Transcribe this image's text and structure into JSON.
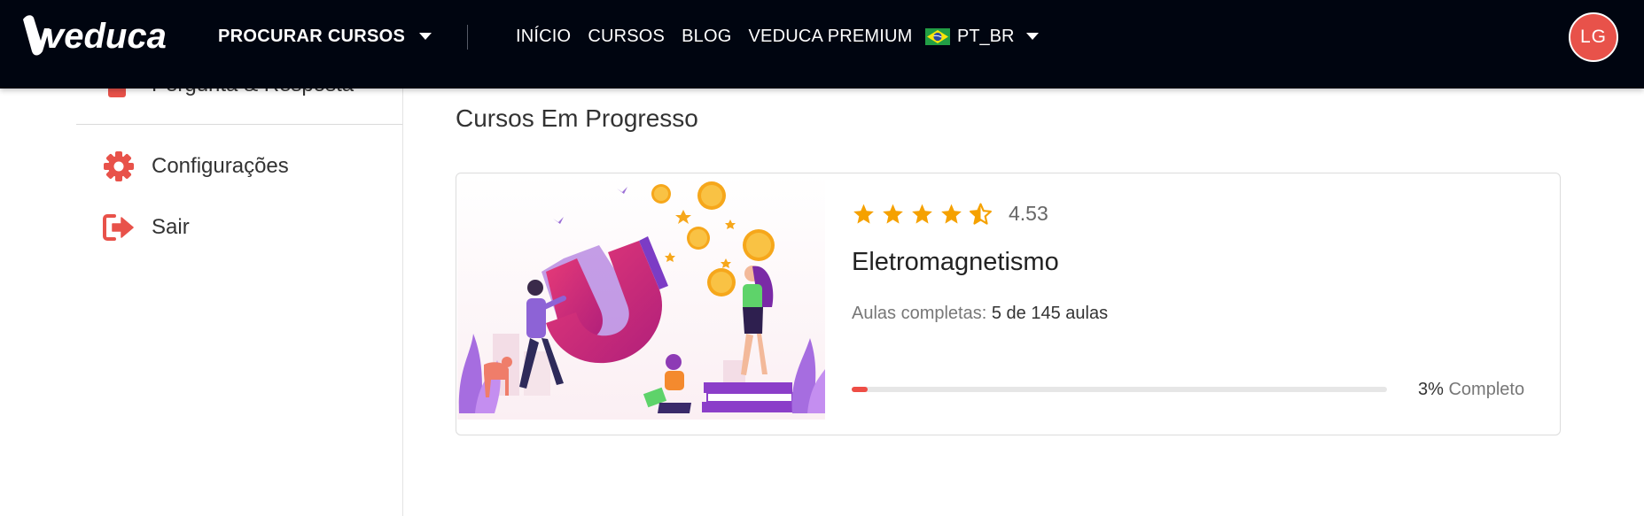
{
  "header": {
    "brand": "veduca",
    "browse_label": "PROCURAR CURSOS",
    "nav": [
      "INÍCIO",
      "CURSOS",
      "BLOG",
      "VEDUCA PREMIUM"
    ],
    "language": "PT_BR",
    "user_initials": "LG",
    "colors": {
      "bar": "#000510",
      "avatar": "#e8524a"
    }
  },
  "sidebar": {
    "partial_item": "Pergunta & Resposta",
    "items": [
      {
        "label": "Configurações",
        "icon": "gear-icon"
      },
      {
        "label": "Sair",
        "icon": "sign-out-icon"
      }
    ],
    "accent": "#e8524a"
  },
  "main": {
    "section_title": "Cursos Em Progresso",
    "course": {
      "rating": 4.53,
      "rating_text": "4.53",
      "title": "Eletromagnetismo",
      "lessons_label": "Aulas completas:",
      "lessons_value": "5 de 145 aulas",
      "progress_percent": 3,
      "progress_percent_text": "3%",
      "progress_suffix": "Completo",
      "progress_color": "#ee4d45"
    }
  }
}
